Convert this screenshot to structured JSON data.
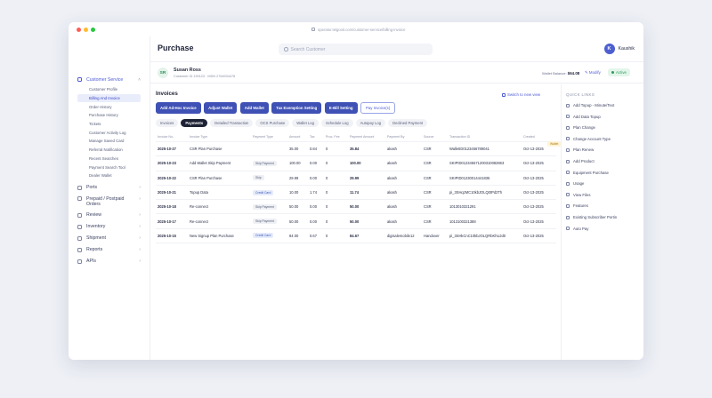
{
  "browser": {
    "url": "operator.telgooit.com/customer-service/billing-invoice",
    "dot_colors": [
      "#ff5f57",
      "#febc2e",
      "#28c840"
    ]
  },
  "header": {
    "title": "Purchase",
    "search_placeholder": "Search Customer",
    "user_initial": "K",
    "user_name": "Kaushik"
  },
  "sidebar": {
    "items": [
      {
        "label": "Customer Service",
        "icon": "user-icon",
        "active": true,
        "expanded": true
      },
      {
        "label": "Ports",
        "icon": "port-icon"
      },
      {
        "label": "Prepaid / Postpaid Orders",
        "icon": "orders-icon"
      },
      {
        "label": "Review",
        "icon": "review-icon"
      },
      {
        "label": "Inventory",
        "icon": "inventory-icon"
      },
      {
        "label": "Shipment",
        "icon": "shipment-icon"
      },
      {
        "label": "Reports",
        "icon": "reports-icon"
      },
      {
        "label": "APIs",
        "icon": "api-icon"
      }
    ],
    "sub_items": [
      "Customer Profile",
      "Billing And Invoice",
      "Order History",
      "Purchase History",
      "Tickets",
      "Customer Activity Log",
      "Manage Saved Card",
      "Referral Notification",
      "Recent Searches",
      "Payment Search Tool",
      "Dealer Wallet"
    ],
    "selected_sub": 1
  },
  "customer": {
    "initials": "SR",
    "name": "Susan Ross",
    "meta": "Customer ID 190123 · MDN 2764934478",
    "wallet_label": "Wallet Balance:",
    "wallet_value": "$64.08",
    "modify": "Modify",
    "status": "Active"
  },
  "invoices": {
    "title": "Invoices",
    "switch_view": "Switch to new view",
    "buttons": [
      "Add Ad-Hoc Invoice",
      "Adjust Wallet",
      "Add Wallet",
      "Tax Exemption Setting",
      "E-Bill Setting",
      "Pay Invoice(s)"
    ],
    "tabs": [
      "Invoices",
      "Payments",
      "Detailed Transaction",
      "OCS Purchase",
      "Wallet Log",
      "Schedule Log",
      "Autopay Log",
      "Declined Payment"
    ],
    "active_tab": 1,
    "columns": [
      "Invoice No.",
      "Invoice Type",
      "Payment Type",
      "Amount",
      "Tax",
      "Proc. Fee",
      "Payment Amount",
      "Payment By",
      "Source",
      "Transaction ID",
      "Created"
    ],
    "rows": [
      [
        "2025-10-27",
        "CSR Plan Purchase",
        "Wallet",
        "35.00",
        "0.84",
        "0",
        "35.84",
        "akash",
        "CSR",
        "WalletID0123456789041",
        "Oct-13-2025"
      ],
      [
        "2025-10-23",
        "Add Wallet Skip Payment",
        "Skip Payment",
        "100.00",
        "0.00",
        "0",
        "100.00",
        "akash",
        "CSR",
        "SKIPID012345671200310082863",
        "Oct-13-2025"
      ],
      [
        "2025-10-22",
        "CSR Plan Purchase",
        "Skip",
        "29.99",
        "0.00",
        "0",
        "29.99",
        "akash",
        "CSR",
        "SKIPID01230014441835",
        "Oct-13-2025"
      ],
      [
        "2025-10-21",
        "Topup Data",
        "Credit Card",
        "10.00",
        "1.74",
        "0",
        "11.74",
        "akash",
        "CSR",
        "pi_3SHqzMC10kbJOLQ0tPd2Th",
        "Oct-13-2025"
      ],
      [
        "2025-10-18",
        "Re-connect",
        "Skip Payment",
        "50.00",
        "0.00",
        "0",
        "50.00",
        "akash",
        "CSR",
        "1013010321291",
        "Oct-13-2025"
      ],
      [
        "2025-10-17",
        "Re-connect",
        "Skip Payment",
        "50.00",
        "0.00",
        "0",
        "50.00",
        "akash",
        "CSR",
        "1013100321388",
        "Oct-13-2025"
      ],
      [
        "2025-10-15",
        "New Signup Plan Purchase",
        "Credit Card",
        "84.00",
        "0.67",
        "0",
        "84.67",
        "digisalemobile12",
        "Handover",
        "pi_3SHkCnC10kbJOLQRbKhUJd0",
        "Oct-13-2025"
      ]
    ]
  },
  "quick_links": {
    "title": "QUICK LINKS",
    "items": [
      "Add Topup - Minute/Text",
      "Add Data Topup",
      "Plan Change",
      "Change Account Type",
      "Plan Renew",
      "Add Product",
      "Equipment Purchase",
      "Usage",
      "View Files",
      "Features",
      "Existing Subscriber Portin",
      "Auto Pay"
    ]
  }
}
